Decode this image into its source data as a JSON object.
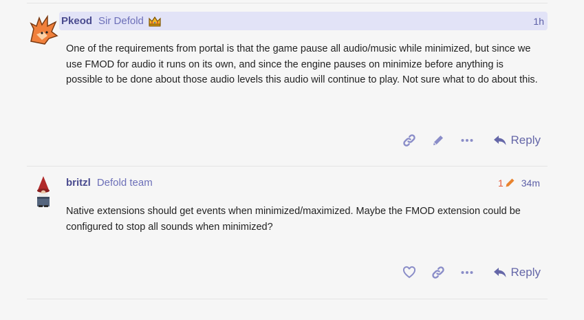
{
  "posts": [
    {
      "username": "Pkeod",
      "user_title": "Sir Defold",
      "time": "1h",
      "body": "One of the requirements from portal is that the game pause all audio/music while minimized, but since we use FMOD for audio it runs on its own, and since the engine pauses on minimize before anything is possible to be done about those audio levels this audio will continue to play. Not sure what to do about this.",
      "reply_label": "Reply"
    },
    {
      "username": "britzl",
      "user_title": "Defold team",
      "edit_count": "1",
      "time": "34m",
      "body": "Native extensions should get events when minimized/maximized. Maybe the FMOD extension could be configured to stop all sounds when minimized?",
      "reply_label": "Reply"
    }
  ],
  "colors": {
    "highlight": "#e2e3f7",
    "accent": "#6567a8",
    "edit": "#e45735"
  }
}
